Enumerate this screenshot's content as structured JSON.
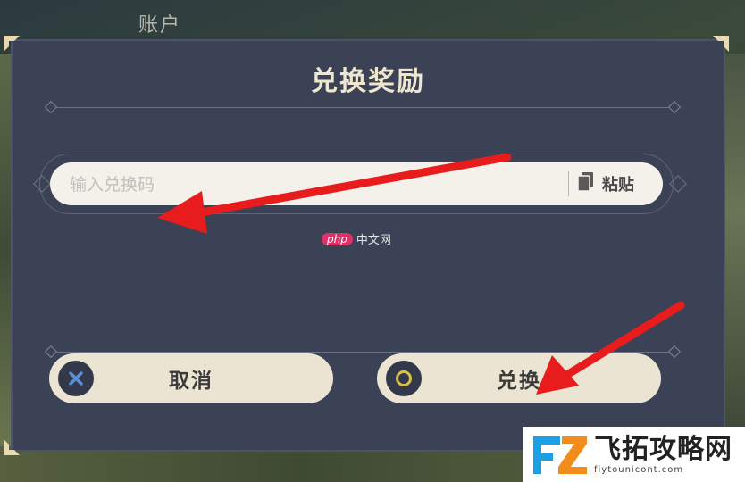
{
  "header": {
    "account_label": "账户"
  },
  "dialog": {
    "title": "兑换奖励",
    "code_input": {
      "value": "",
      "placeholder": "输入兑换码"
    },
    "paste_label": "粘贴",
    "cancel_label": "取消",
    "confirm_label": "兑换"
  },
  "watermark": {
    "php_badge": "php",
    "php_text": "中文网"
  },
  "brand": {
    "name": "飞拓攻略网",
    "url": "fiytounicont.com"
  },
  "colors": {
    "dialog_bg": "#3b4255",
    "title": "#efe6cf",
    "button_bg": "#ebe4d2",
    "input_bg": "#f3f1ea",
    "cancel_icon": "#5b8fd8",
    "confirm_icon": "#d8c04a",
    "arrow": "#e81c1c",
    "brand_blue": "#1aa0e6"
  },
  "icons": {
    "cancel": "x-circle-icon",
    "confirm": "o-circle-icon",
    "paste": "clipboard-icon",
    "corner": "ornament-corner-icon"
  }
}
